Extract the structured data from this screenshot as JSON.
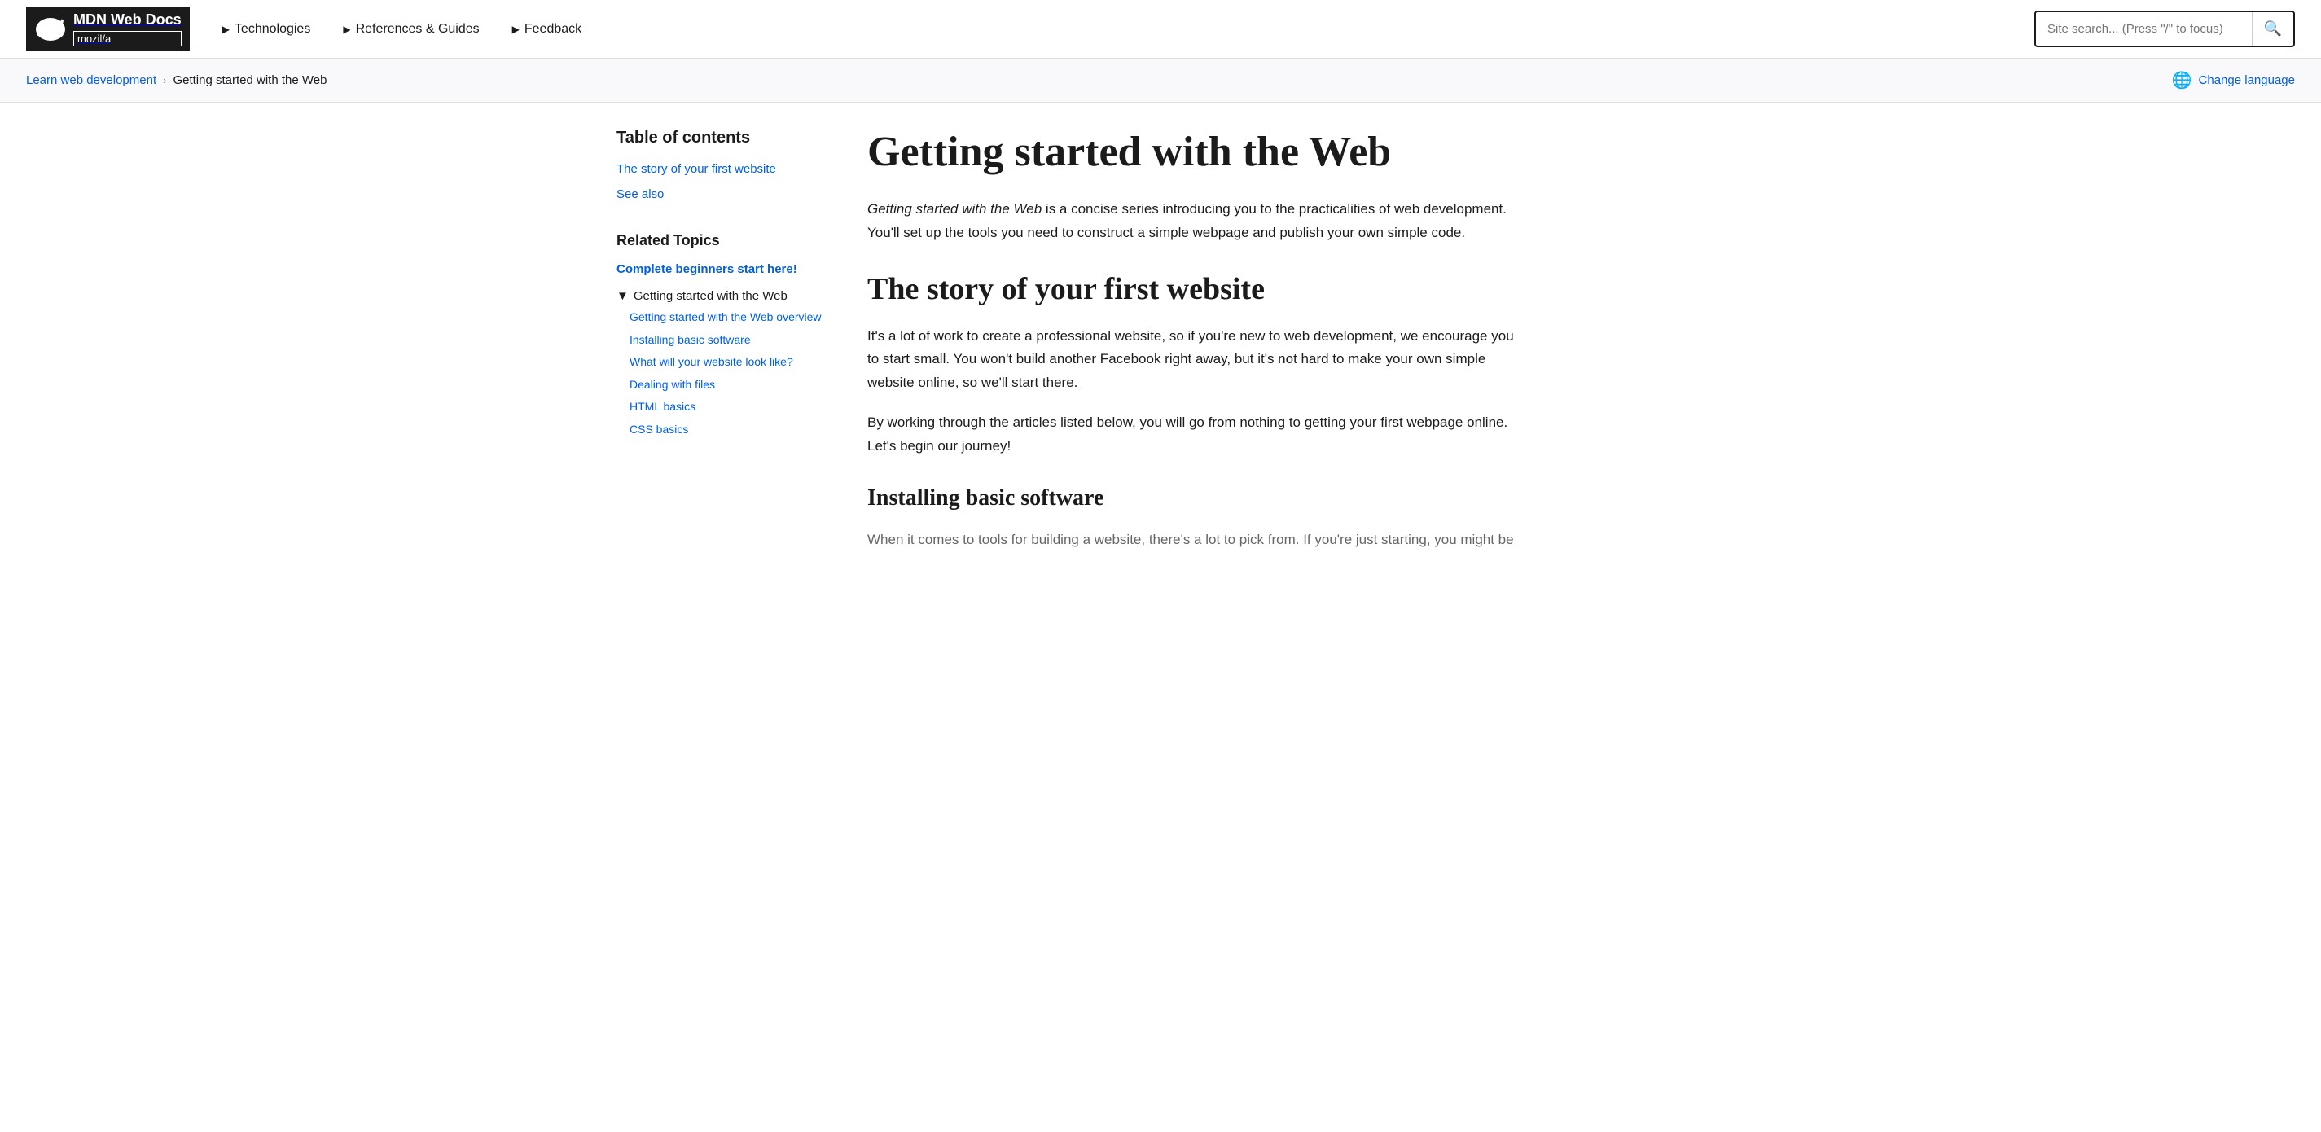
{
  "header": {
    "logo_title": "MDN Web Docs",
    "logo_subtitle": "mozil/a",
    "nav_items": [
      {
        "label": "Technologies"
      },
      {
        "label": "References & Guides"
      },
      {
        "label": "Feedback"
      }
    ],
    "search_placeholder": "Site search... (Press \"/\" to focus)"
  },
  "breadcrumb": {
    "parent_label": "Learn web development",
    "separator": "›",
    "current_label": "Getting started with the Web"
  },
  "change_language_label": "Change language",
  "sidebar": {
    "toc_title": "Table of contents",
    "toc_links": [
      {
        "label": "The story of your first website"
      },
      {
        "label": "See also"
      }
    ],
    "related_topics_title": "Related Topics",
    "complete_beginners_label": "Complete beginners start here!",
    "related_section_label": "Getting started with the Web",
    "sub_links": [
      {
        "label": "Getting started with the Web overview"
      },
      {
        "label": "Installing basic software"
      },
      {
        "label": "What will your website look like?"
      },
      {
        "label": "Dealing with files"
      },
      {
        "label": "HTML basics"
      },
      {
        "label": "CSS basics"
      }
    ]
  },
  "content": {
    "page_title": "Getting started with the Web",
    "intro_italic": "Getting started with the Web",
    "intro_rest": " is a concise series introducing you to the practicalities of web development. You'll set up the tools you need to construct a simple webpage and publish your own simple code.",
    "section1_title": "The story of your first website",
    "section1_para1": "It's a lot of work to create a professional website, so if you're new to web development, we encourage you to start small. You won't build another Facebook right away, but it's not hard to make your own simple website online, so we'll start there.",
    "section1_para2": "By working through the articles listed below,  you will go from nothing to getting your first webpage online. Let's begin our journey!",
    "section2_title": "Installing basic software",
    "section2_para": "When it comes to tools for building a website, there's a lot to pick from. If you're just starting, you might be"
  }
}
